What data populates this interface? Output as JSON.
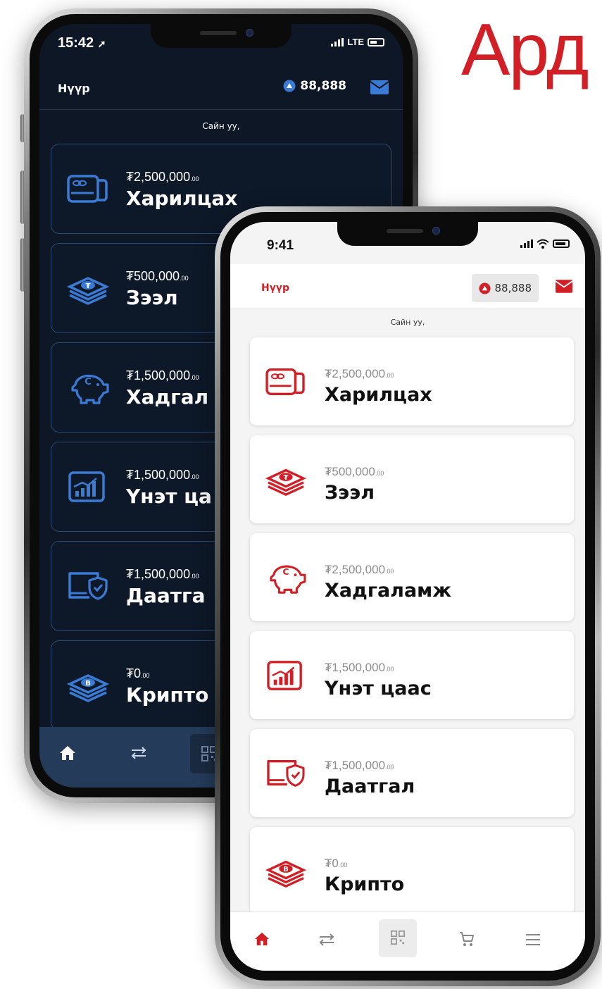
{
  "brand": {
    "text": "Ард"
  },
  "colors": {
    "accent": "#d21f26",
    "dark_bg": "#0e1726",
    "dark_nav": "#243b5a",
    "card_border_dark": "#2a4a75"
  },
  "back_phone": {
    "status": {
      "time": "15:42",
      "network": "LTE"
    },
    "header": {
      "title": "Нүүр",
      "points": "88,888"
    },
    "greeting": "Сайн уу,",
    "accounts": [
      {
        "icon": "card-icon",
        "currency": "₮",
        "amount": "2,500,000",
        "decimals": ".00",
        "name": "Харилцах"
      },
      {
        "icon": "coins-stack-icon",
        "currency": "₮",
        "amount": "500,000",
        "decimals": ".00",
        "name": "Зээл"
      },
      {
        "icon": "piggy-bank-icon",
        "currency": "₮",
        "amount": "1,500,000",
        "decimals": ".00",
        "name": "Хадгал"
      },
      {
        "icon": "stock-chart-icon",
        "currency": "₮",
        "amount": "1,500,000",
        "decimals": ".00",
        "name": "Үнэт ца"
      },
      {
        "icon": "insurance-shield-icon",
        "currency": "₮",
        "amount": "1,500,000",
        "decimals": ".00",
        "name": "Даатга"
      },
      {
        "icon": "crypto-coin-icon",
        "currency": "₮",
        "amount": "0",
        "decimals": ".00",
        "name": "Крипто"
      }
    ]
  },
  "front_phone": {
    "status": {
      "time": "9:41"
    },
    "header": {
      "title": "Нүүр",
      "points": "88,888"
    },
    "greeting": "Сайн уу,",
    "accounts": [
      {
        "icon": "card-icon",
        "currency": "₮",
        "amount": "2,500,000",
        "decimals": ".00",
        "name": "Харилцах"
      },
      {
        "icon": "coins-stack-icon",
        "currency": "₮",
        "amount": "500,000",
        "decimals": ".00",
        "name": "Зээл"
      },
      {
        "icon": "piggy-bank-icon",
        "currency": "₮",
        "amount": "2,500,000",
        "decimals": ".00",
        "name": "Хадгаламж"
      },
      {
        "icon": "stock-chart-icon",
        "currency": "₮",
        "amount": "1,500,000",
        "decimals": ".00",
        "name": "Үнэт цаас"
      },
      {
        "icon": "insurance-shield-icon",
        "currency": "₮",
        "amount": "1,500,000",
        "decimals": ".00",
        "name": "Даатгал"
      },
      {
        "icon": "crypto-coin-icon",
        "currency": "₮",
        "amount": "0",
        "decimals": ".00",
        "name": "Крипто"
      }
    ],
    "nav": [
      "home-icon",
      "transfer-icon",
      "qr-code-icon",
      "cart-icon",
      "menu-icon"
    ]
  }
}
